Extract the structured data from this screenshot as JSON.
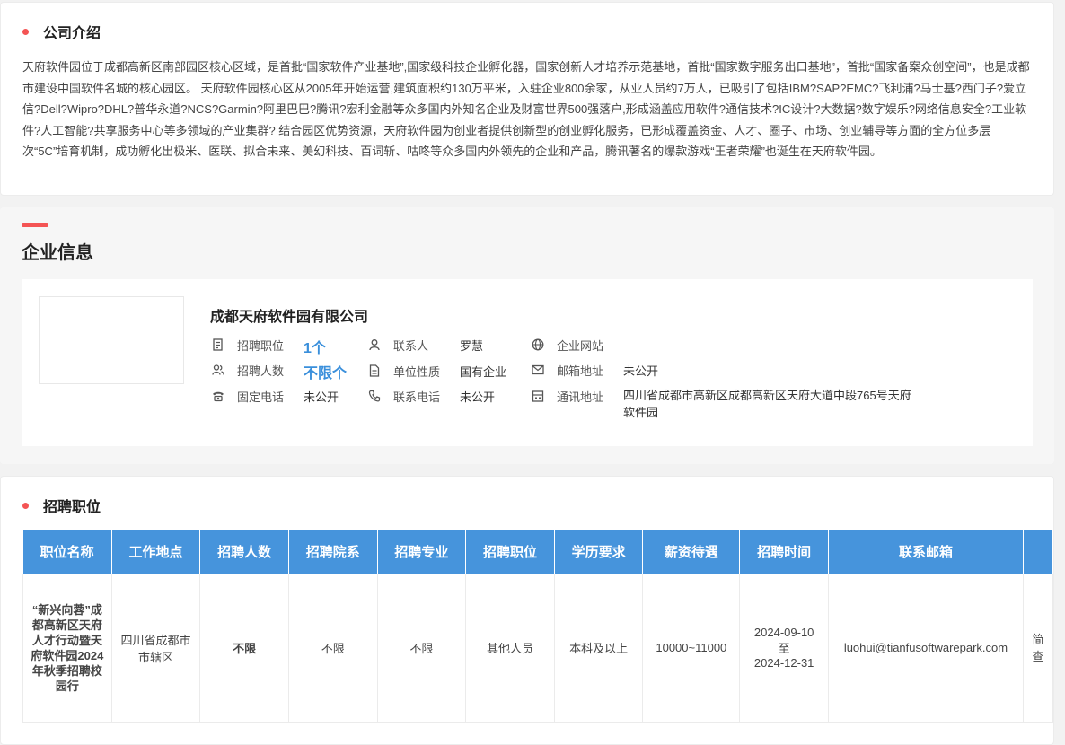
{
  "intro": {
    "title": "公司介绍",
    "text": "天府软件园位于成都高新区南部园区核心区域，是首批“国家软件产业基地”,国家级科技企业孵化器，国家创新人才培养示范基地，首批“国家数字服务出口基地”，首批“国家备案众创空间”，也是成都市建设中国软件名城的核心园区。 天府软件园核心区从2005年开始运营,建筑面积约130万平米，入驻企业800余家，从业人员约7万人，已吸引了包括IBM?SAP?EMC?飞利浦?马士基?西门子?爱立信?Dell?Wipro?DHL?普华永道?NCS?Garmin?阿里巴巴?腾讯?宏利金融等众多国内外知名企业及财富世界500强落户,形成涵盖应用软件?通信技术?IC设计?大数据?数字娱乐?网络信息安全?工业软件?人工智能?共享服务中心等多领域的产业集群? 结合园区优势资源，天府软件园为创业者提供创新型的创业孵化服务，已形成覆盖资金、人才、圈子、市场、创业辅导等方面的全方位多层次“5C”培育机制，成功孵化出极米、医联、拟合未来、美幻科技、百词斩、咕咚等众多国内外领先的企业和产品，腾讯著名的爆款游戏“王者荣耀”也诞生在天府软件园。"
  },
  "company": {
    "section_title": "企业信息",
    "name": "成都天府软件园有限公司",
    "col1": [
      {
        "label": "招聘职位",
        "value": "1个",
        "icon": "document-icon"
      },
      {
        "label": "招聘人数",
        "value": "不限个",
        "icon": "users-icon"
      },
      {
        "label": "固定电话",
        "value": "未公开",
        "icon": "telephone-icon"
      }
    ],
    "col2": [
      {
        "label": "联系人",
        "value": "罗慧",
        "icon": "person-icon"
      },
      {
        "label": "单位性质",
        "value": "国有企业",
        "icon": "file-icon"
      },
      {
        "label": "联系电话",
        "value": "未公开",
        "icon": "phone-icon"
      }
    ],
    "col3": [
      {
        "label": "企业网站",
        "value": "",
        "icon": "globe-icon"
      },
      {
        "label": "邮箱地址",
        "value": "未公开",
        "icon": "mail-icon"
      },
      {
        "label": "通讯地址",
        "value": "四川省成都市高新区成都高新区天府大道中段765号天府软件园",
        "icon": "building-icon"
      }
    ],
    "accent_color": "#3a8fdb"
  },
  "jobs": {
    "title": "招聘职位",
    "headers": [
      "职位名称",
      "工作地点",
      "招聘人数",
      "招聘院系",
      "招聘专业",
      "招聘职位",
      "学历要求",
      "薪资待遇",
      "招聘时间",
      "联系邮箱",
      ""
    ],
    "rows": [
      {
        "name": "“新兴向蓉”成都高新区天府人才行动暨天府软件园2024年秋季招聘校园行",
        "location": "四川省成都市市辖区",
        "count": "不限",
        "department": "不限",
        "major": "不限",
        "position": "其他人员",
        "education": "本科及以上",
        "salary": "10000~11000",
        "time_start": "2024-09-10",
        "time_sep": "至",
        "time_end": "2024-12-31",
        "email": "luohui@tianfusoftwarepark.com",
        "action": "简查"
      }
    ],
    "header_color": "#4694dc"
  }
}
